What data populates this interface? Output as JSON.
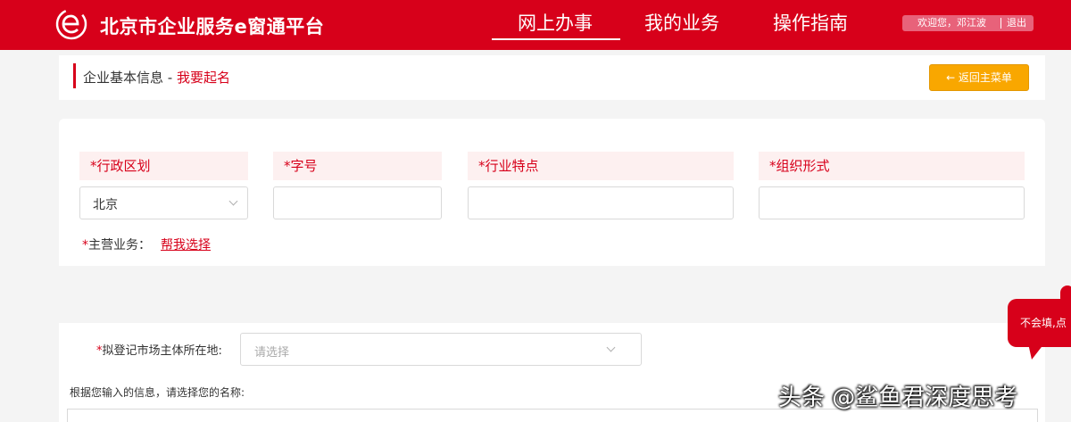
{
  "header": {
    "site_title": "北京市企业服务e窗通平台",
    "nav": [
      "网上办事",
      "我的业务",
      "操作指南"
    ],
    "user_greeting": "欢迎您，邓江波",
    "logout": "退出"
  },
  "breadcrumb": {
    "section": "企业基本信息 - ",
    "current": "我要起名",
    "back_button": "← 返回主菜单"
  },
  "form": {
    "fields": [
      {
        "label": "*行政区划",
        "value": "北京"
      },
      {
        "label": "*字号",
        "value": ""
      },
      {
        "label": "*行业特点",
        "value": ""
      },
      {
        "label": "*组织形式",
        "value": ""
      }
    ],
    "main_business_star": "*",
    "main_business_label": "主营业务：",
    "main_business_link": "帮我选择"
  },
  "location": {
    "label_star": "*",
    "label": "拟登记市场主体所在地:",
    "placeholder": "请选择"
  },
  "name_prompt": "根据您输入的信息，请选择您的名称:",
  "help_bubble": "不会填,点",
  "watermark": "头条 @鲨鱼君深度思考",
  "colors": {
    "brand_red": "#d7001a",
    "button_orange": "#f9a700"
  }
}
